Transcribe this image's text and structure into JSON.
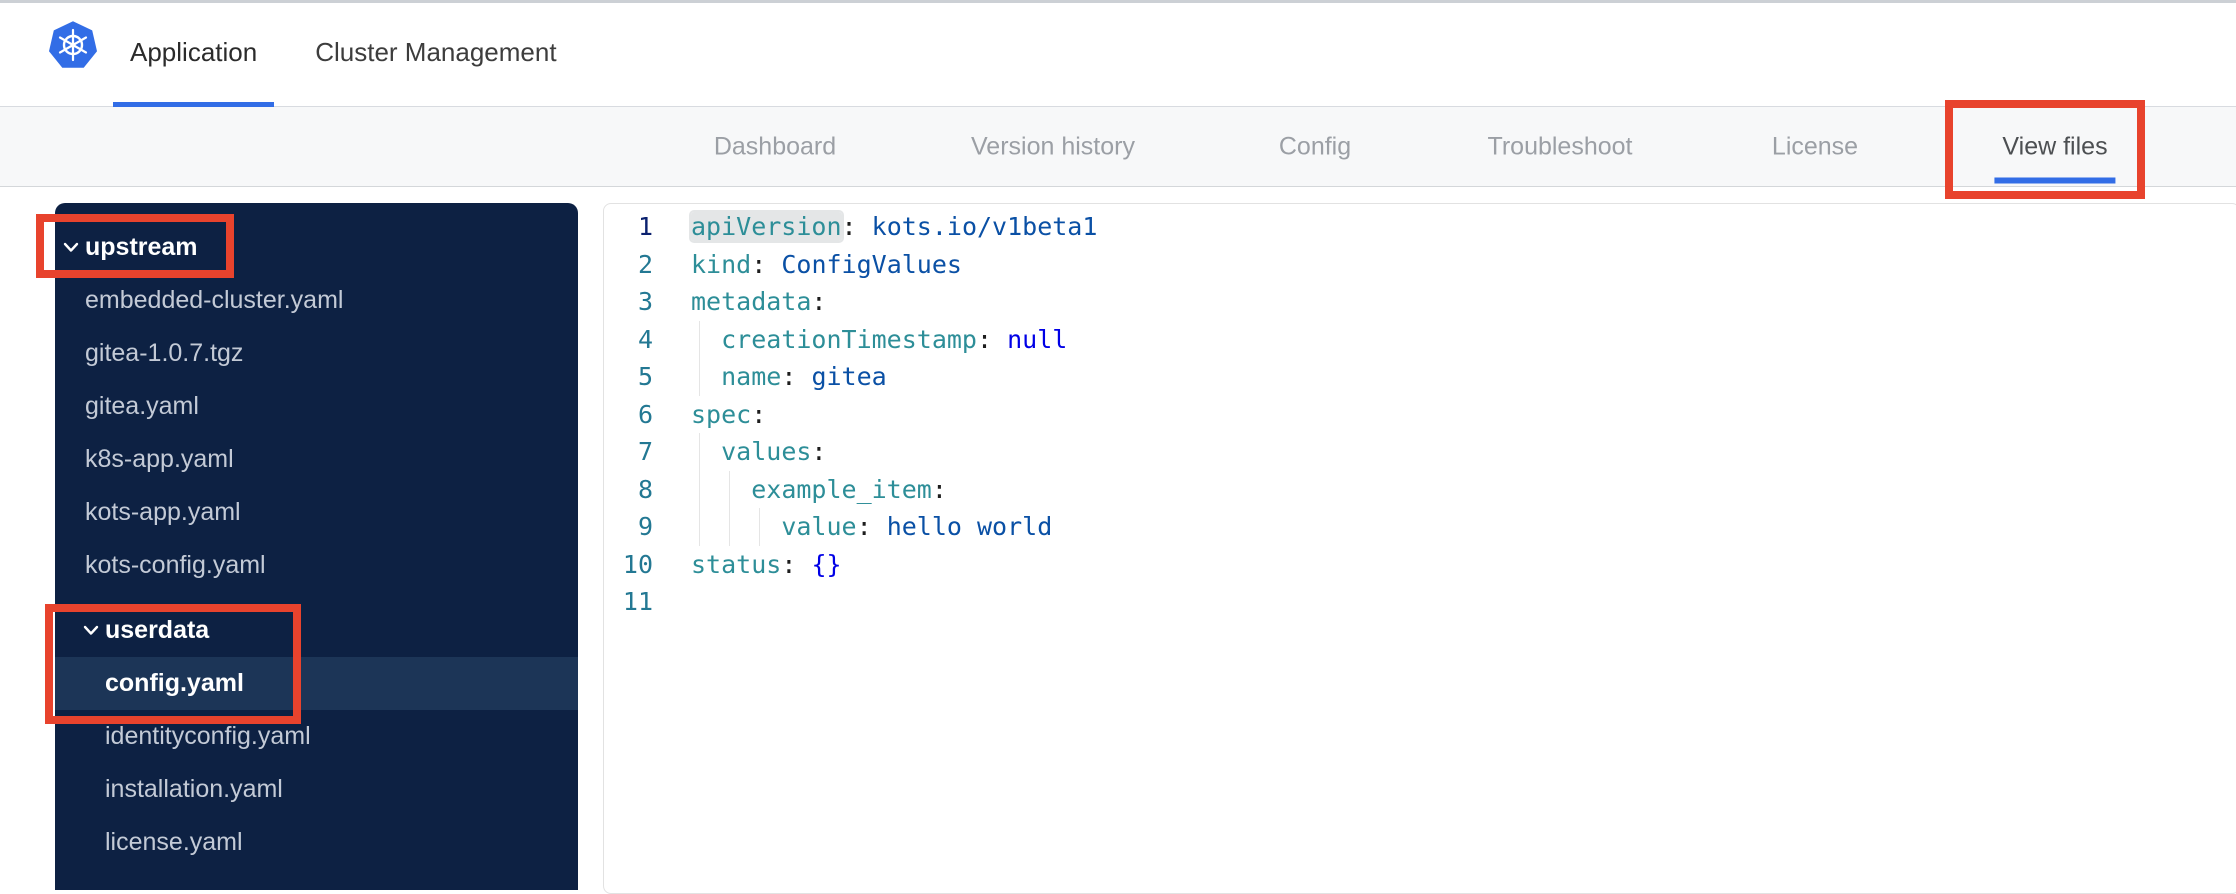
{
  "header": {
    "tabs": [
      {
        "label": "Application",
        "active": true
      },
      {
        "label": "Cluster Management",
        "active": false
      }
    ]
  },
  "subnav": {
    "items": [
      {
        "label": "Dashboard",
        "active": false
      },
      {
        "label": "Version history",
        "active": false
      },
      {
        "label": "Config",
        "active": false
      },
      {
        "label": "Troubleshoot",
        "active": false
      },
      {
        "label": "License",
        "active": false
      },
      {
        "label": "View files",
        "active": true
      }
    ]
  },
  "file_tree": [
    {
      "type": "folder",
      "label": "upstream",
      "level": 0,
      "expanded": true,
      "selected": false
    },
    {
      "type": "file",
      "label": "embedded-cluster.yaml",
      "level": 0,
      "selected": false
    },
    {
      "type": "file",
      "label": "gitea-1.0.7.tgz",
      "level": 0,
      "selected": false
    },
    {
      "type": "file",
      "label": "gitea.yaml",
      "level": 0,
      "selected": false
    },
    {
      "type": "file",
      "label": "k8s-app.yaml",
      "level": 0,
      "selected": false
    },
    {
      "type": "file",
      "label": "kots-app.yaml",
      "level": 0,
      "selected": false
    },
    {
      "type": "file",
      "label": "kots-config.yaml",
      "level": 0,
      "selected": false
    },
    {
      "type": "folder",
      "label": "userdata",
      "level": 1,
      "expanded": true,
      "selected": false
    },
    {
      "type": "file",
      "label": "config.yaml",
      "level": 1,
      "selected": true
    },
    {
      "type": "file",
      "label": "identityconfig.yaml",
      "level": 1,
      "selected": false
    },
    {
      "type": "file",
      "label": "installation.yaml",
      "level": 1,
      "selected": false
    },
    {
      "type": "file",
      "label": "license.yaml",
      "level": 1,
      "selected": false
    }
  ],
  "editor": {
    "language": "yaml",
    "lines": [
      {
        "num": 1,
        "indent": 0,
        "key": "apiVersion",
        "value": "kots.io/v1beta1",
        "value_type": "string",
        "key_highlight": true
      },
      {
        "num": 2,
        "indent": 0,
        "key": "kind",
        "value": "ConfigValues",
        "value_type": "string",
        "key_highlight": false
      },
      {
        "num": 3,
        "indent": 0,
        "key": "metadata",
        "value": "",
        "value_type": "none",
        "key_highlight": false
      },
      {
        "num": 4,
        "indent": 2,
        "key": "creationTimestamp",
        "value": "null",
        "value_type": "keyword",
        "key_highlight": false
      },
      {
        "num": 5,
        "indent": 2,
        "key": "name",
        "value": "gitea",
        "value_type": "string",
        "key_highlight": false
      },
      {
        "num": 6,
        "indent": 0,
        "key": "spec",
        "value": "",
        "value_type": "none",
        "key_highlight": false
      },
      {
        "num": 7,
        "indent": 2,
        "key": "values",
        "value": "",
        "value_type": "none",
        "key_highlight": false
      },
      {
        "num": 8,
        "indent": 4,
        "key": "example_item",
        "value": "",
        "value_type": "none",
        "key_highlight": false
      },
      {
        "num": 9,
        "indent": 6,
        "key": "value",
        "value": "hello world",
        "value_type": "string",
        "key_highlight": false
      },
      {
        "num": 10,
        "indent": 0,
        "key": "status",
        "value": "{}",
        "value_type": "keyword",
        "key_highlight": false
      },
      {
        "num": 11,
        "indent": 0,
        "key": "",
        "value": "",
        "value_type": "none",
        "key_highlight": false
      }
    ]
  },
  "colors": {
    "accent_blue": "#326de6",
    "annotation_red": "#e8432d",
    "sidebar_bg": "#0d2143",
    "sidebar_selected_bg": "#1c3557",
    "sidebar_file_text": "#c3cad6",
    "sidebar_folder_text": "#ffffff",
    "nav_inactive": "#9b9fa5",
    "nav_active": "#4c4f52",
    "code_key": "#2d8e98",
    "code_string": "#0a50a5",
    "code_keyword": "#0000e6",
    "code_punct": "#1d1d1d",
    "line_number": "#237893",
    "line_number_active": "#0b216f"
  }
}
